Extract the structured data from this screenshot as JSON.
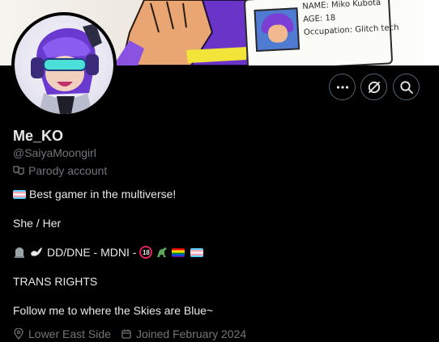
{
  "banner": {
    "id_card": {
      "line1": "NAME: Miko Kubota",
      "line2": "AGE: 18",
      "line3": "Occupation: Glitch tech"
    }
  },
  "actions": {
    "more_icon": "more-horizontal-icon",
    "grok_icon": "grok-icon",
    "search_icon": "search-icon"
  },
  "profile": {
    "display_name": "Me_KO",
    "handle": "@SaiyaMoongirl",
    "parody_label": "Parody account",
    "bio": {
      "line1": "Best gamer in the multiverse!",
      "line2": "She / Her",
      "line3": "DD/DNE - MDNI -",
      "line4": "TRANS RIGHTS",
      "line5": "Follow me to where the Skies are Blue~"
    },
    "location": "Lower East Side",
    "joined": "Joined February 2024"
  },
  "colors": {
    "background": "#000000",
    "text": "#e7e9ea",
    "muted": "#71767b",
    "border": "#536471"
  }
}
